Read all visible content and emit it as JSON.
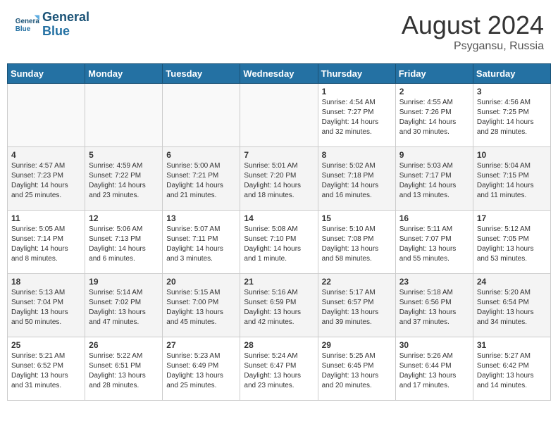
{
  "header": {
    "logo_line1": "General",
    "logo_line2": "Blue",
    "month": "August 2024",
    "location": "Psygansu, Russia"
  },
  "weekdays": [
    "Sunday",
    "Monday",
    "Tuesday",
    "Wednesday",
    "Thursday",
    "Friday",
    "Saturday"
  ],
  "weeks": [
    [
      {
        "day": "",
        "sunrise": "",
        "sunset": "",
        "daylight": ""
      },
      {
        "day": "",
        "sunrise": "",
        "sunset": "",
        "daylight": ""
      },
      {
        "day": "",
        "sunrise": "",
        "sunset": "",
        "daylight": ""
      },
      {
        "day": "",
        "sunrise": "",
        "sunset": "",
        "daylight": ""
      },
      {
        "day": "1",
        "sunrise": "Sunrise: 4:54 AM",
        "sunset": "Sunset: 7:27 PM",
        "daylight": "Daylight: 14 hours and 32 minutes."
      },
      {
        "day": "2",
        "sunrise": "Sunrise: 4:55 AM",
        "sunset": "Sunset: 7:26 PM",
        "daylight": "Daylight: 14 hours and 30 minutes."
      },
      {
        "day": "3",
        "sunrise": "Sunrise: 4:56 AM",
        "sunset": "Sunset: 7:25 PM",
        "daylight": "Daylight: 14 hours and 28 minutes."
      }
    ],
    [
      {
        "day": "4",
        "sunrise": "Sunrise: 4:57 AM",
        "sunset": "Sunset: 7:23 PM",
        "daylight": "Daylight: 14 hours and 25 minutes."
      },
      {
        "day": "5",
        "sunrise": "Sunrise: 4:59 AM",
        "sunset": "Sunset: 7:22 PM",
        "daylight": "Daylight: 14 hours and 23 minutes."
      },
      {
        "day": "6",
        "sunrise": "Sunrise: 5:00 AM",
        "sunset": "Sunset: 7:21 PM",
        "daylight": "Daylight: 14 hours and 21 minutes."
      },
      {
        "day": "7",
        "sunrise": "Sunrise: 5:01 AM",
        "sunset": "Sunset: 7:20 PM",
        "daylight": "Daylight: 14 hours and 18 minutes."
      },
      {
        "day": "8",
        "sunrise": "Sunrise: 5:02 AM",
        "sunset": "Sunset: 7:18 PM",
        "daylight": "Daylight: 14 hours and 16 minutes."
      },
      {
        "day": "9",
        "sunrise": "Sunrise: 5:03 AM",
        "sunset": "Sunset: 7:17 PM",
        "daylight": "Daylight: 14 hours and 13 minutes."
      },
      {
        "day": "10",
        "sunrise": "Sunrise: 5:04 AM",
        "sunset": "Sunset: 7:15 PM",
        "daylight": "Daylight: 14 hours and 11 minutes."
      }
    ],
    [
      {
        "day": "11",
        "sunrise": "Sunrise: 5:05 AM",
        "sunset": "Sunset: 7:14 PM",
        "daylight": "Daylight: 14 hours and 8 minutes."
      },
      {
        "day": "12",
        "sunrise": "Sunrise: 5:06 AM",
        "sunset": "Sunset: 7:13 PM",
        "daylight": "Daylight: 14 hours and 6 minutes."
      },
      {
        "day": "13",
        "sunrise": "Sunrise: 5:07 AM",
        "sunset": "Sunset: 7:11 PM",
        "daylight": "Daylight: 14 hours and 3 minutes."
      },
      {
        "day": "14",
        "sunrise": "Sunrise: 5:08 AM",
        "sunset": "Sunset: 7:10 PM",
        "daylight": "Daylight: 14 hours and 1 minute."
      },
      {
        "day": "15",
        "sunrise": "Sunrise: 5:10 AM",
        "sunset": "Sunset: 7:08 PM",
        "daylight": "Daylight: 13 hours and 58 minutes."
      },
      {
        "day": "16",
        "sunrise": "Sunrise: 5:11 AM",
        "sunset": "Sunset: 7:07 PM",
        "daylight": "Daylight: 13 hours and 55 minutes."
      },
      {
        "day": "17",
        "sunrise": "Sunrise: 5:12 AM",
        "sunset": "Sunset: 7:05 PM",
        "daylight": "Daylight: 13 hours and 53 minutes."
      }
    ],
    [
      {
        "day": "18",
        "sunrise": "Sunrise: 5:13 AM",
        "sunset": "Sunset: 7:04 PM",
        "daylight": "Daylight: 13 hours and 50 minutes."
      },
      {
        "day": "19",
        "sunrise": "Sunrise: 5:14 AM",
        "sunset": "Sunset: 7:02 PM",
        "daylight": "Daylight: 13 hours and 47 minutes."
      },
      {
        "day": "20",
        "sunrise": "Sunrise: 5:15 AM",
        "sunset": "Sunset: 7:00 PM",
        "daylight": "Daylight: 13 hours and 45 minutes."
      },
      {
        "day": "21",
        "sunrise": "Sunrise: 5:16 AM",
        "sunset": "Sunset: 6:59 PM",
        "daylight": "Daylight: 13 hours and 42 minutes."
      },
      {
        "day": "22",
        "sunrise": "Sunrise: 5:17 AM",
        "sunset": "Sunset: 6:57 PM",
        "daylight": "Daylight: 13 hours and 39 minutes."
      },
      {
        "day": "23",
        "sunrise": "Sunrise: 5:18 AM",
        "sunset": "Sunset: 6:56 PM",
        "daylight": "Daylight: 13 hours and 37 minutes."
      },
      {
        "day": "24",
        "sunrise": "Sunrise: 5:20 AM",
        "sunset": "Sunset: 6:54 PM",
        "daylight": "Daylight: 13 hours and 34 minutes."
      }
    ],
    [
      {
        "day": "25",
        "sunrise": "Sunrise: 5:21 AM",
        "sunset": "Sunset: 6:52 PM",
        "daylight": "Daylight: 13 hours and 31 minutes."
      },
      {
        "day": "26",
        "sunrise": "Sunrise: 5:22 AM",
        "sunset": "Sunset: 6:51 PM",
        "daylight": "Daylight: 13 hours and 28 minutes."
      },
      {
        "day": "27",
        "sunrise": "Sunrise: 5:23 AM",
        "sunset": "Sunset: 6:49 PM",
        "daylight": "Daylight: 13 hours and 25 minutes."
      },
      {
        "day": "28",
        "sunrise": "Sunrise: 5:24 AM",
        "sunset": "Sunset: 6:47 PM",
        "daylight": "Daylight: 13 hours and 23 minutes."
      },
      {
        "day": "29",
        "sunrise": "Sunrise: 5:25 AM",
        "sunset": "Sunset: 6:45 PM",
        "daylight": "Daylight: 13 hours and 20 minutes."
      },
      {
        "day": "30",
        "sunrise": "Sunrise: 5:26 AM",
        "sunset": "Sunset: 6:44 PM",
        "daylight": "Daylight: 13 hours and 17 minutes."
      },
      {
        "day": "31",
        "sunrise": "Sunrise: 5:27 AM",
        "sunset": "Sunset: 6:42 PM",
        "daylight": "Daylight: 13 hours and 14 minutes."
      }
    ]
  ]
}
